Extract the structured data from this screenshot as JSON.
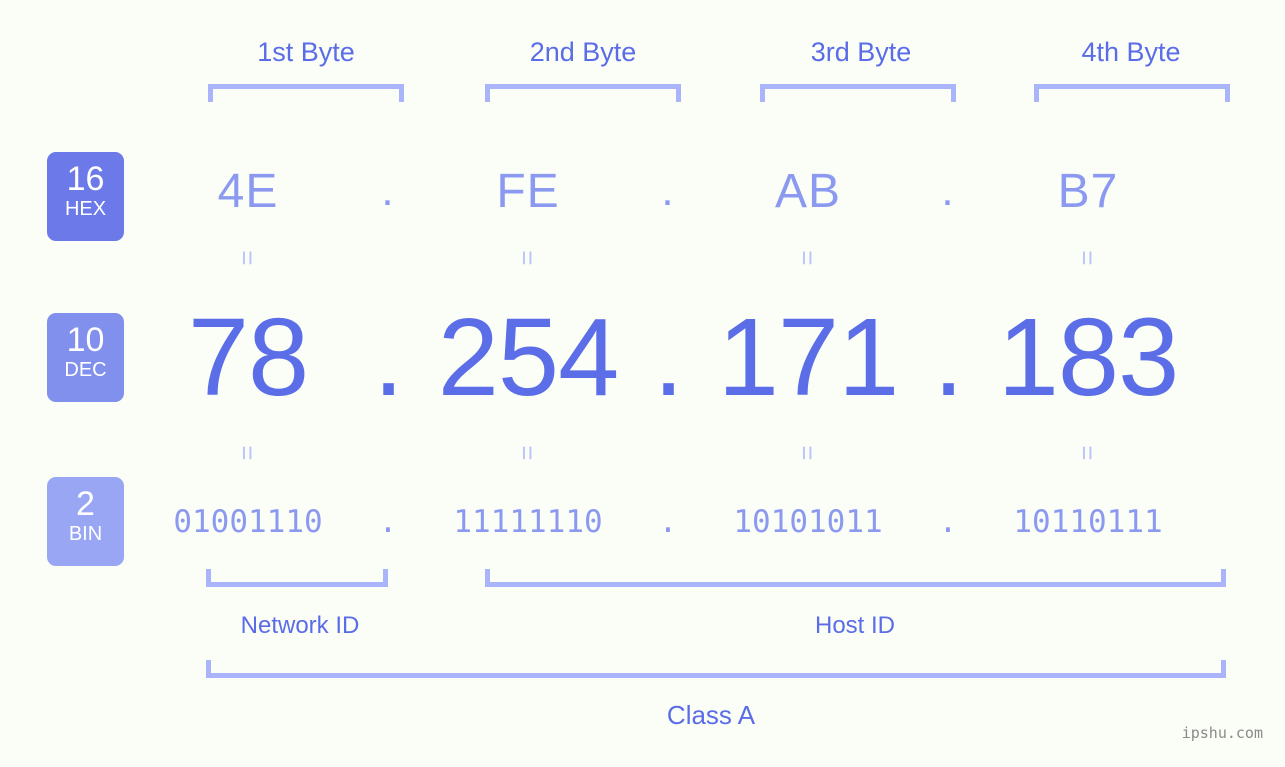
{
  "background_color": "#fbfdf7",
  "accent_color": "#5b6ee8",
  "bracket_color": "#aab4fb",
  "byte_headers": [
    {
      "label": "1st Byte"
    },
    {
      "label": "2nd Byte"
    },
    {
      "label": "3rd Byte"
    },
    {
      "label": "4th Byte"
    }
  ],
  "badges": [
    {
      "base": "16",
      "system": "HEX",
      "color": "#6b7ae8"
    },
    {
      "base": "10",
      "system": "DEC",
      "color": "#818fed"
    },
    {
      "base": "2",
      "system": "BIN",
      "color": "#98a6f4"
    }
  ],
  "rows": {
    "hex": {
      "system": "HEX",
      "base": "16",
      "octets": [
        "4E",
        "FE",
        "AB",
        "B7"
      ],
      "separator": "."
    },
    "dec": {
      "system": "DEC",
      "base": "10",
      "octets": [
        "78",
        "254",
        "171",
        "183"
      ],
      "separator": "."
    },
    "bin": {
      "system": "BIN",
      "base": "2",
      "octets": [
        "01001110",
        "11111110",
        "10101011",
        "10110111"
      ],
      "separator": "."
    }
  },
  "equality_marks": {
    "glyph": "=",
    "count_per_row": 4
  },
  "sections": [
    {
      "name": "network-id",
      "label": "Network ID"
    },
    {
      "name": "host-id",
      "label": "Host ID"
    }
  ],
  "class_label": "Class A",
  "watermark": "ipshu.com"
}
